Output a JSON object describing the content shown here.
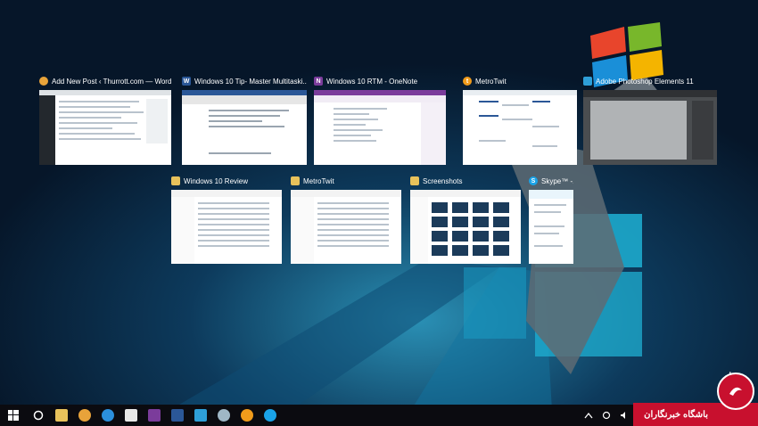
{
  "colors": {
    "desktop_dark": "#071a2e",
    "taskbar": "#0b0b10",
    "accent_red": "#c8102e",
    "cyan_light": "#1fb0d3"
  },
  "task_view": {
    "row1": [
      {
        "title": "Add New Post ‹ Thurrott.com — WordP...",
        "icon": "chrome-icon",
        "icon_color": "#e8a33a",
        "icon_text": ""
      },
      {
        "title": "Windows 10 Tip- Master Multitaski...",
        "icon": "word-icon",
        "icon_color": "#2b5797",
        "icon_text": "W"
      },
      {
        "title": "Windows 10 RTM - OneNote",
        "icon": "onenote-icon",
        "icon_color": "#7b3c9b",
        "icon_text": "N"
      },
      {
        "title": "MetroTwit",
        "icon": "metrotwit-icon",
        "icon_color": "#f09b1b",
        "icon_text": "t"
      },
      {
        "title": "Adobe Photoshop Elements 11",
        "icon": "photoshop-elements-icon",
        "icon_color": "#2e9fd8",
        "icon_text": ""
      }
    ],
    "row2": [
      {
        "title": "Windows 10 Review",
        "icon": "folder-icon",
        "icon_color": "#e8c25b",
        "icon_text": ""
      },
      {
        "title": "MetroTwit",
        "icon": "folder-icon",
        "icon_color": "#e8c25b",
        "icon_text": ""
      },
      {
        "title": "Screenshots",
        "icon": "folder-icon",
        "icon_color": "#e8c25b",
        "icon_text": ""
      },
      {
        "title": "Skype™ -...",
        "icon": "skype-icon",
        "icon_color": "#1aa3e8",
        "icon_text": "S"
      }
    ]
  },
  "new_desktop": {
    "label": "+"
  },
  "taskbar": {
    "items": [
      {
        "name": "start-icon",
        "color": "#ffffff"
      },
      {
        "name": "search-icon",
        "color": "#ffffff"
      },
      {
        "name": "file-explorer-icon",
        "color": "#e8c25b"
      },
      {
        "name": "chrome-icon",
        "color": "#e8a33a"
      },
      {
        "name": "edge-icon",
        "color": "#2b8fdc"
      },
      {
        "name": "store-icon",
        "color": "#e8e8e8"
      },
      {
        "name": "onenote-icon",
        "color": "#7b3c9b"
      },
      {
        "name": "word-icon",
        "color": "#2b5797"
      },
      {
        "name": "photoshop-elements-icon",
        "color": "#2e9fd8"
      },
      {
        "name": "network-globe-icon",
        "color": "#9fb7c6"
      },
      {
        "name": "metrotwit-icon",
        "color": "#f09b1b"
      },
      {
        "name": "skype-icon",
        "color": "#1aa3e8"
      }
    ],
    "tray_icons": [
      "chevron-up-icon",
      "sync-icon",
      "volume-icon"
    ]
  },
  "watermark": {
    "text": "باشگاه خبرنگاران"
  }
}
